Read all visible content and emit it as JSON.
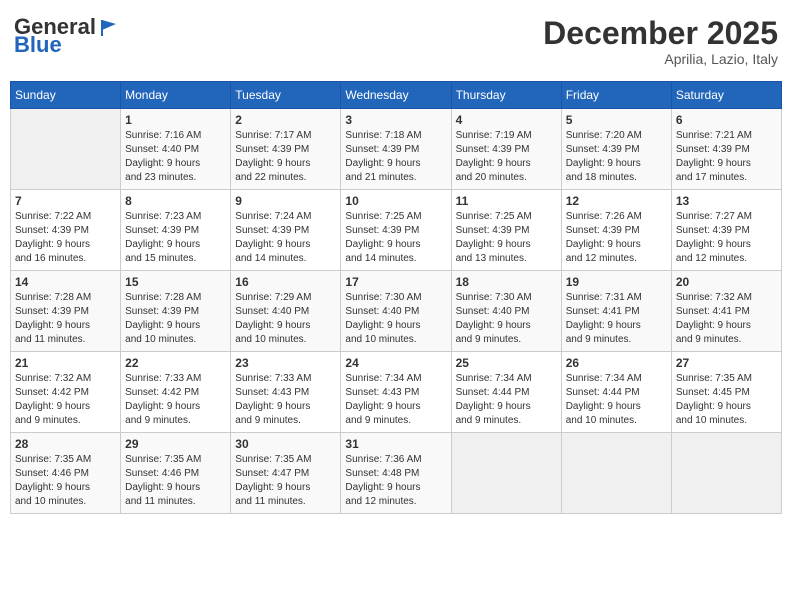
{
  "header": {
    "logo_general": "General",
    "logo_blue": "Blue",
    "month_title": "December 2025",
    "location": "Aprilia, Lazio, Italy"
  },
  "weekdays": [
    "Sunday",
    "Monday",
    "Tuesday",
    "Wednesday",
    "Thursday",
    "Friday",
    "Saturday"
  ],
  "weeks": [
    [
      {
        "day": "",
        "info": ""
      },
      {
        "day": "1",
        "info": "Sunrise: 7:16 AM\nSunset: 4:40 PM\nDaylight: 9 hours\nand 23 minutes."
      },
      {
        "day": "2",
        "info": "Sunrise: 7:17 AM\nSunset: 4:39 PM\nDaylight: 9 hours\nand 22 minutes."
      },
      {
        "day": "3",
        "info": "Sunrise: 7:18 AM\nSunset: 4:39 PM\nDaylight: 9 hours\nand 21 minutes."
      },
      {
        "day": "4",
        "info": "Sunrise: 7:19 AM\nSunset: 4:39 PM\nDaylight: 9 hours\nand 20 minutes."
      },
      {
        "day": "5",
        "info": "Sunrise: 7:20 AM\nSunset: 4:39 PM\nDaylight: 9 hours\nand 18 minutes."
      },
      {
        "day": "6",
        "info": "Sunrise: 7:21 AM\nSunset: 4:39 PM\nDaylight: 9 hours\nand 17 minutes."
      }
    ],
    [
      {
        "day": "7",
        "info": "Sunrise: 7:22 AM\nSunset: 4:39 PM\nDaylight: 9 hours\nand 16 minutes."
      },
      {
        "day": "8",
        "info": "Sunrise: 7:23 AM\nSunset: 4:39 PM\nDaylight: 9 hours\nand 15 minutes."
      },
      {
        "day": "9",
        "info": "Sunrise: 7:24 AM\nSunset: 4:39 PM\nDaylight: 9 hours\nand 14 minutes."
      },
      {
        "day": "10",
        "info": "Sunrise: 7:25 AM\nSunset: 4:39 PM\nDaylight: 9 hours\nand 14 minutes."
      },
      {
        "day": "11",
        "info": "Sunrise: 7:25 AM\nSunset: 4:39 PM\nDaylight: 9 hours\nand 13 minutes."
      },
      {
        "day": "12",
        "info": "Sunrise: 7:26 AM\nSunset: 4:39 PM\nDaylight: 9 hours\nand 12 minutes."
      },
      {
        "day": "13",
        "info": "Sunrise: 7:27 AM\nSunset: 4:39 PM\nDaylight: 9 hours\nand 12 minutes."
      }
    ],
    [
      {
        "day": "14",
        "info": "Sunrise: 7:28 AM\nSunset: 4:39 PM\nDaylight: 9 hours\nand 11 minutes."
      },
      {
        "day": "15",
        "info": "Sunrise: 7:28 AM\nSunset: 4:39 PM\nDaylight: 9 hours\nand 10 minutes."
      },
      {
        "day": "16",
        "info": "Sunrise: 7:29 AM\nSunset: 4:40 PM\nDaylight: 9 hours\nand 10 minutes."
      },
      {
        "day": "17",
        "info": "Sunrise: 7:30 AM\nSunset: 4:40 PM\nDaylight: 9 hours\nand 10 minutes."
      },
      {
        "day": "18",
        "info": "Sunrise: 7:30 AM\nSunset: 4:40 PM\nDaylight: 9 hours\nand 9 minutes."
      },
      {
        "day": "19",
        "info": "Sunrise: 7:31 AM\nSunset: 4:41 PM\nDaylight: 9 hours\nand 9 minutes."
      },
      {
        "day": "20",
        "info": "Sunrise: 7:32 AM\nSunset: 4:41 PM\nDaylight: 9 hours\nand 9 minutes."
      }
    ],
    [
      {
        "day": "21",
        "info": "Sunrise: 7:32 AM\nSunset: 4:42 PM\nDaylight: 9 hours\nand 9 minutes."
      },
      {
        "day": "22",
        "info": "Sunrise: 7:33 AM\nSunset: 4:42 PM\nDaylight: 9 hours\nand 9 minutes."
      },
      {
        "day": "23",
        "info": "Sunrise: 7:33 AM\nSunset: 4:43 PM\nDaylight: 9 hours\nand 9 minutes."
      },
      {
        "day": "24",
        "info": "Sunrise: 7:34 AM\nSunset: 4:43 PM\nDaylight: 9 hours\nand 9 minutes."
      },
      {
        "day": "25",
        "info": "Sunrise: 7:34 AM\nSunset: 4:44 PM\nDaylight: 9 hours\nand 9 minutes."
      },
      {
        "day": "26",
        "info": "Sunrise: 7:34 AM\nSunset: 4:44 PM\nDaylight: 9 hours\nand 10 minutes."
      },
      {
        "day": "27",
        "info": "Sunrise: 7:35 AM\nSunset: 4:45 PM\nDaylight: 9 hours\nand 10 minutes."
      }
    ],
    [
      {
        "day": "28",
        "info": "Sunrise: 7:35 AM\nSunset: 4:46 PM\nDaylight: 9 hours\nand 10 minutes."
      },
      {
        "day": "29",
        "info": "Sunrise: 7:35 AM\nSunset: 4:46 PM\nDaylight: 9 hours\nand 11 minutes."
      },
      {
        "day": "30",
        "info": "Sunrise: 7:35 AM\nSunset: 4:47 PM\nDaylight: 9 hours\nand 11 minutes."
      },
      {
        "day": "31",
        "info": "Sunrise: 7:36 AM\nSunset: 4:48 PM\nDaylight: 9 hours\nand 12 minutes."
      },
      {
        "day": "",
        "info": ""
      },
      {
        "day": "",
        "info": ""
      },
      {
        "day": "",
        "info": ""
      }
    ]
  ]
}
